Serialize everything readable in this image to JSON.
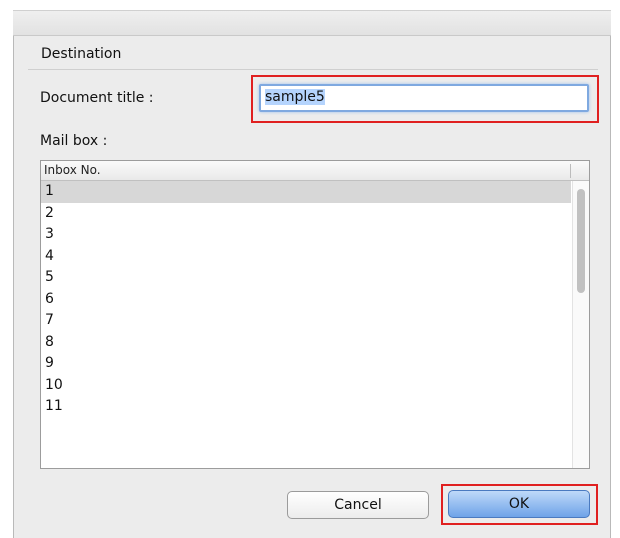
{
  "destination": {
    "section_title": "Destination",
    "document_title_label": "Document title :",
    "document_title_value": "sample5",
    "mailbox_label": "Mail box :"
  },
  "mailbox_list": {
    "column_header": "Inbox No.",
    "items": [
      "1",
      "2",
      "3",
      "4",
      "5",
      "6",
      "7",
      "8",
      "9",
      "10",
      "11"
    ],
    "selected_item": "1"
  },
  "buttons": {
    "cancel_label": "Cancel",
    "ok_label": "OK"
  },
  "colors": {
    "highlight_annotation": "#e02020",
    "selection_row": "#d7d7d7",
    "default_button": "#6ea3e8"
  }
}
